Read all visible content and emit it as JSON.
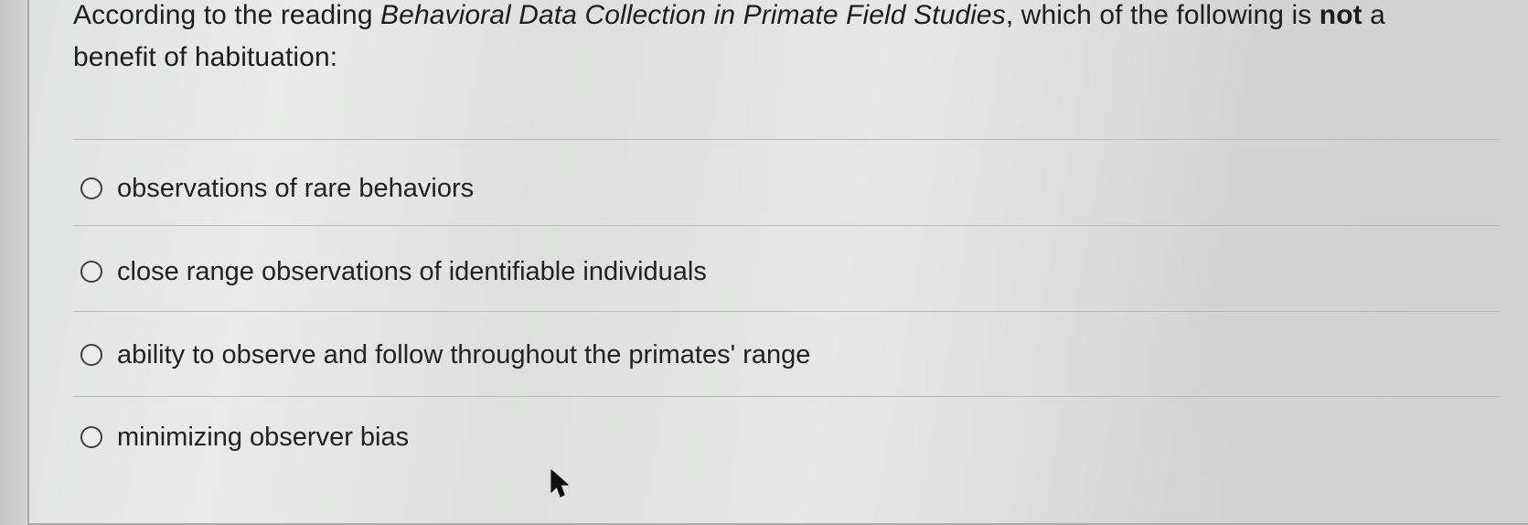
{
  "question": {
    "prefix": "According to the reading ",
    "reading_title": "Behavioral Data Collection in Primate Field Studies",
    "middle": ", which of the following is ",
    "emphasis": "not",
    "suffix": " a benefit of habituation:"
  },
  "options": [
    {
      "label": "observations of rare behaviors",
      "selected": false
    },
    {
      "label": "close range observations of identifiable individuals",
      "selected": false
    },
    {
      "label": "ability to observe and follow throughout the primates' range",
      "selected": false
    },
    {
      "label": "minimizing observer bias",
      "selected": false
    }
  ],
  "icons": {
    "radio": "radio-button-unchecked",
    "cursor": "mouse-pointer-arrow"
  }
}
